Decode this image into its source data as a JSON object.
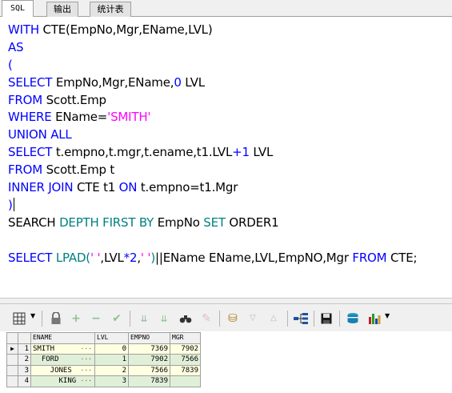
{
  "tabs": [
    {
      "label": "SQL",
      "active": true
    },
    {
      "label": "输出",
      "active": false
    },
    {
      "label": "统计表",
      "active": false
    }
  ],
  "editor": {
    "lines": [
      [
        {
          "t": "WITH ",
          "c": "kw"
        },
        {
          "t": "CTE(EmpNo,Mgr,EName,LVL)",
          "c": ""
        }
      ],
      [
        {
          "t": "AS",
          "c": "kw"
        }
      ],
      [
        {
          "t": "(",
          "c": "kw"
        }
      ],
      [
        {
          "t": "SELECT ",
          "c": "kw"
        },
        {
          "t": "EmpNo,Mgr,EName,",
          "c": ""
        },
        {
          "t": "0",
          "c": "num"
        },
        {
          "t": " LVL",
          "c": ""
        }
      ],
      [
        {
          "t": "FROM ",
          "c": "kw"
        },
        {
          "t": "Scott.Emp",
          "c": ""
        }
      ],
      [
        {
          "t": "WHERE ",
          "c": "kw"
        },
        {
          "t": "EName=",
          "c": ""
        },
        {
          "t": "'SMITH'",
          "c": "str"
        }
      ],
      [
        {
          "t": "UNION ALL",
          "c": "kw"
        }
      ],
      [
        {
          "t": "SELECT ",
          "c": "kw"
        },
        {
          "t": "t.empno,t.mgr,t.ename,t1.LVL",
          "c": ""
        },
        {
          "t": "+1",
          "c": "num"
        },
        {
          "t": " LVL",
          "c": ""
        }
      ],
      [
        {
          "t": "FROM ",
          "c": "kw"
        },
        {
          "t": "Scott.Emp t",
          "c": ""
        }
      ],
      [
        {
          "t": "INNER JOIN ",
          "c": "kw"
        },
        {
          "t": "CTE t1 ",
          "c": ""
        },
        {
          "t": "ON ",
          "c": "kw"
        },
        {
          "t": "t.empno=t1.Mgr",
          "c": ""
        }
      ],
      [
        {
          "t": ")",
          "c": "kw"
        },
        {
          "t": "",
          "c": "caret"
        }
      ],
      [
        {
          "t": "SEARCH ",
          "c": ""
        },
        {
          "t": "DEPTH FIRST BY ",
          "c": "kw2"
        },
        {
          "t": "EmpNo ",
          "c": ""
        },
        {
          "t": "SET ",
          "c": "kw2"
        },
        {
          "t": "ORDER1",
          "c": ""
        }
      ],
      [],
      [
        {
          "t": "SELECT ",
          "c": "kw"
        },
        {
          "t": "LPAD(",
          "c": "kw2"
        },
        {
          "t": "' '",
          "c": "str"
        },
        {
          "t": ",LVL",
          "c": ""
        },
        {
          "t": "*2",
          "c": "num"
        },
        {
          "t": ",",
          "c": ""
        },
        {
          "t": "' '",
          "c": "str"
        },
        {
          "t": ")",
          "c": "kw2"
        },
        {
          "t": "||EName EName,LVL,EmpNO,Mgr ",
          "c": ""
        },
        {
          "t": "FROM ",
          "c": "kw"
        },
        {
          "t": "CTE;",
          "c": ""
        }
      ]
    ]
  },
  "toolbar": {
    "icons": [
      "grid-icon",
      "lock-icon",
      "add-icon",
      "remove-icon",
      "post-icon",
      "first-icon",
      "last-icon",
      "find-icon",
      "clear-icon",
      "query-icon",
      "next-icon",
      "prev-icon",
      "tree-icon",
      "save-icon",
      "db-icon",
      "chart-icon"
    ]
  },
  "grid": {
    "columns": [
      "ENAME",
      "LVL",
      "EMPNO",
      "MGR"
    ],
    "rows": [
      {
        "no": "1",
        "ename": "SMITH",
        "lvl": "0",
        "empno": "7369",
        "mgr": "7902"
      },
      {
        "no": "2",
        "ename": "  FORD",
        "lvl": "1",
        "empno": "7902",
        "mgr": "7566"
      },
      {
        "no": "3",
        "ename": "    JONES",
        "lvl": "2",
        "empno": "7566",
        "mgr": "7839"
      },
      {
        "no": "4",
        "ename": "      KING",
        "lvl": "3",
        "empno": "7839",
        "mgr": ""
      }
    ]
  }
}
